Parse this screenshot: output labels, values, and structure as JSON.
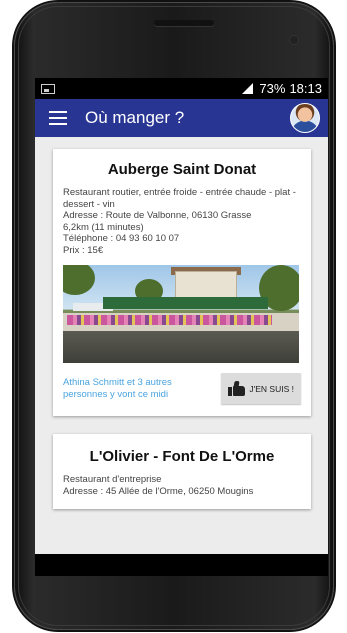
{
  "status_bar": {
    "battery": "73%",
    "time": "18:13"
  },
  "app_bar": {
    "title": "Où manger ?"
  },
  "restaurants": [
    {
      "name": "Auberge Saint Donat",
      "description": "Restaurant routier, entrée froide - entrée chaude - plat - dessert - vin",
      "address": "Adresse : Route de Valbonne, 06130 Grasse",
      "distance": "6,2km (11 minutes)",
      "phone": "Téléphone : 04 93 60 10 07",
      "price": "Prix : 15€",
      "participants": "Athina Schmitt et 3 autres personnes y vont ce midi",
      "join_label": "J'EN SUIS !"
    },
    {
      "name": "L'Olivier - Font De L'Orme",
      "description": "Restaurant d'entreprise",
      "address": "Adresse : 45 Allée de l'Orme, 06250 Mougins"
    }
  ],
  "colors": {
    "app_bar": "#283593",
    "participants_text": "#4aa3df",
    "background": "#ececec",
    "button": "#dcdcdc"
  }
}
